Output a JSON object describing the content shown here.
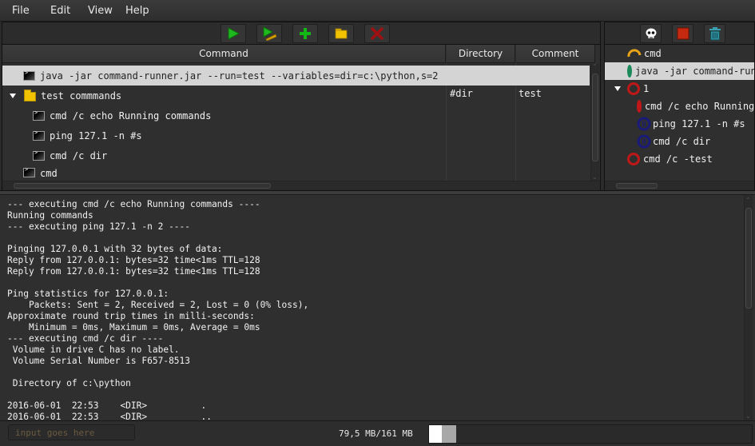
{
  "menu": [
    "File",
    "Edit",
    "View",
    "Help"
  ],
  "toolbar": {
    "buttons": [
      {
        "name": "run-button",
        "icon": "play-icon"
      },
      {
        "name": "run-with-args-button",
        "icon": "play-pencil-icon"
      },
      {
        "name": "add-button",
        "icon": "plus-icon"
      },
      {
        "name": "add-folder-button",
        "icon": "folder-icon"
      },
      {
        "name": "delete-button",
        "icon": "x-icon"
      }
    ]
  },
  "commands_table": {
    "columns": [
      "Command",
      "Directory",
      "Comment"
    ],
    "rows": [
      {
        "type": "command",
        "command": "java -jar command-runner.jar --run=test --variables=dir=c:\\python,s=2",
        "directory": "",
        "comment": "",
        "selected": true,
        "level": 0
      },
      {
        "type": "folder",
        "command": "test commmands",
        "directory": "#dir",
        "comment": "test",
        "expanded": true,
        "level": 0
      },
      {
        "type": "command",
        "command": "cmd /c echo Running commands",
        "directory": "",
        "comment": "",
        "level": 1
      },
      {
        "type": "command",
        "command": "ping 127.1 -n #s",
        "directory": "",
        "comment": "",
        "level": 1
      },
      {
        "type": "command",
        "command": "cmd /c dir",
        "directory": "",
        "comment": "",
        "level": 1
      },
      {
        "type": "command",
        "command": "cmd",
        "directory": "",
        "comment": "",
        "level": 0
      }
    ]
  },
  "runs_toolbar": {
    "buttons": [
      {
        "name": "kill-button",
        "icon": "skull-icon"
      },
      {
        "name": "stop-button",
        "icon": "stop-icon"
      },
      {
        "name": "clear-button",
        "icon": "trash-icon"
      }
    ]
  },
  "runs": {
    "colors": {
      "running": "#e8a317",
      "success": "#1a8a5a",
      "failed": "#c01818",
      "waiting": "#1a1a7a"
    },
    "items": [
      {
        "label": "cmd",
        "status": "running",
        "level": 0
      },
      {
        "label": "java -jar command-runner.jar",
        "status": "success",
        "level": 0,
        "selected": true
      },
      {
        "label": "1",
        "status": "failed",
        "level": 0,
        "expanded": true
      },
      {
        "label": "cmd /c echo Running commands",
        "status": "failed",
        "level": 1
      },
      {
        "label": "ping 127.1 -n #s",
        "status": "waiting",
        "level": 1
      },
      {
        "label": "cmd /c dir",
        "status": "waiting",
        "level": 1
      },
      {
        "label": "cmd /c -test",
        "status": "failed",
        "level": 0
      }
    ]
  },
  "console": {
    "lines": [
      "--- executing cmd /c echo Running commands ----",
      "Running commands",
      "--- executing ping 127.1 -n 2 ----",
      "",
      "Pinging 127.0.0.1 with 32 bytes of data:",
      "Reply from 127.0.0.1: bytes=32 time<1ms TTL=128",
      "Reply from 127.0.0.1: bytes=32 time<1ms TTL=128",
      "",
      "Ping statistics for 127.0.0.1:",
      "    Packets: Sent = 2, Received = 2, Lost = 0 (0% loss),",
      "Approximate round trip times in milli-seconds:",
      "    Minimum = 0ms, Maximum = 0ms, Average = 0ms",
      "--- executing cmd /c dir ----",
      " Volume in drive C has no label.",
      " Volume Serial Number is F657-8513",
      "",
      " Directory of c:\\python",
      "",
      "2016-06-01  22:53    <DIR>          .",
      "2016-06-01  22:53    <DIR>          .."
    ]
  },
  "statusbar": {
    "input_placeholder": "input goes here",
    "input_value": "",
    "memory_text": "79,5 MB/161 MB",
    "memory_used_fraction": 0.04,
    "memory_allocated_fraction": 0.085
  }
}
